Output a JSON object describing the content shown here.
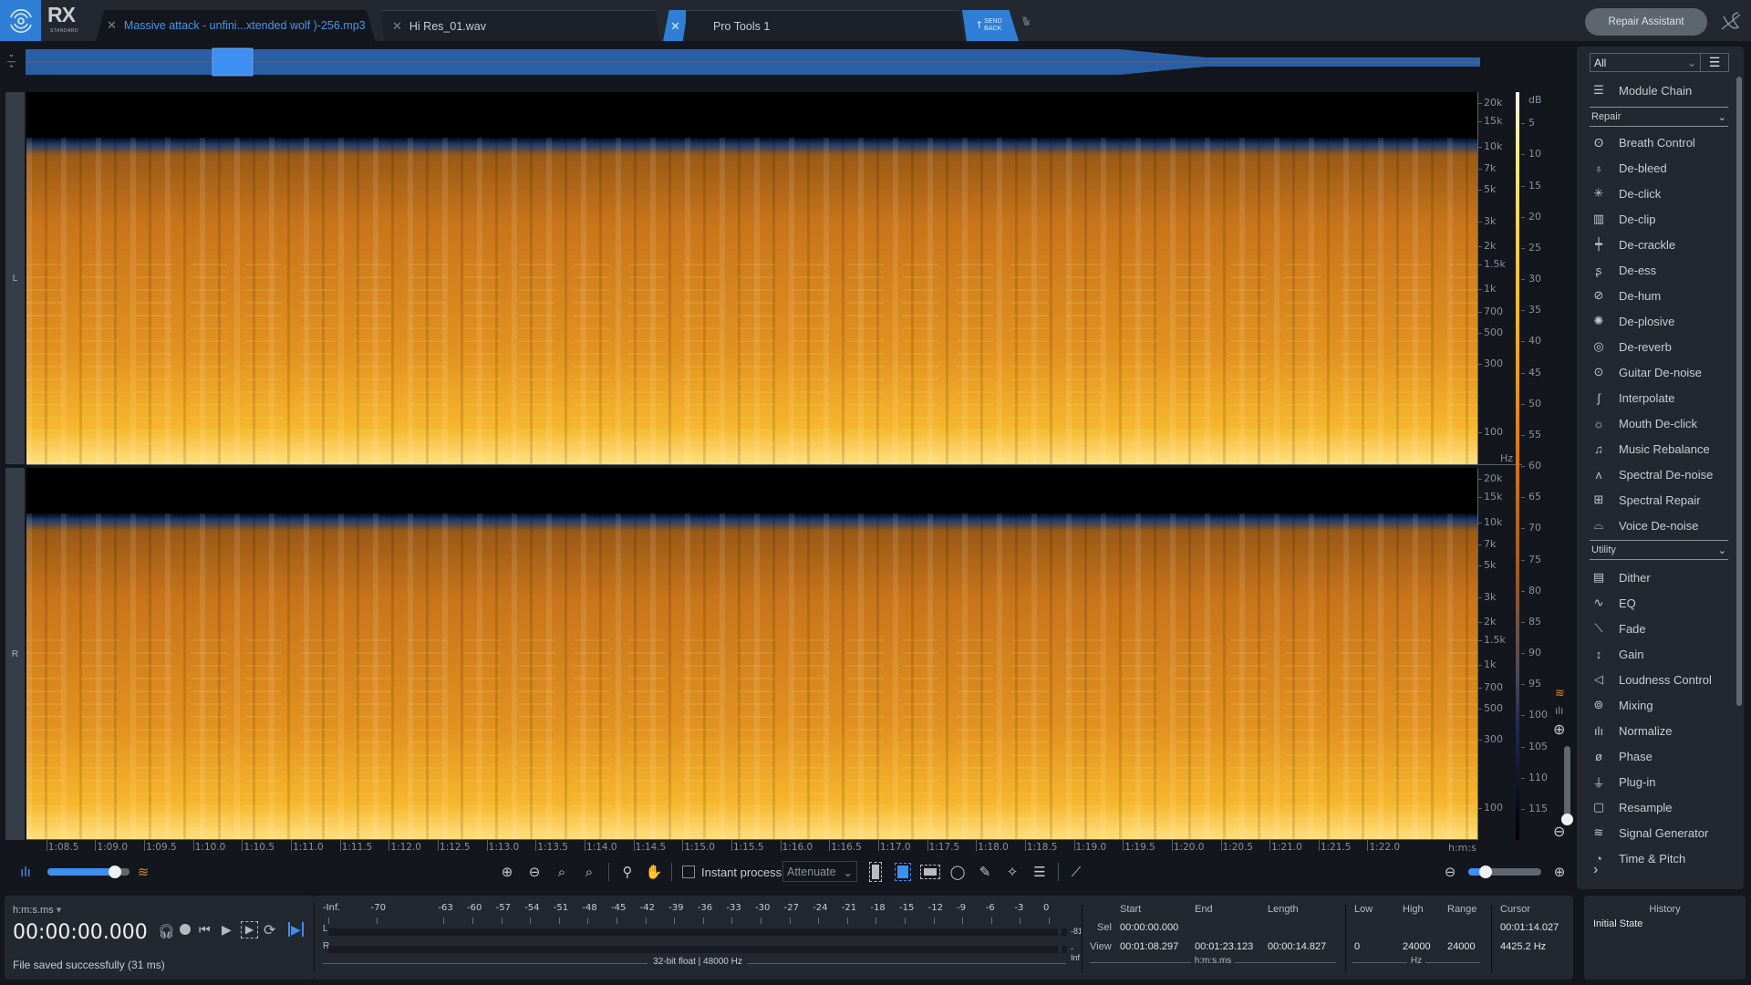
{
  "app": {
    "name": "RX",
    "edition": "STANDARD"
  },
  "tabs": [
    {
      "label": "Massive attack - unfini...xtended wolf )-256.mp3",
      "active": true
    },
    {
      "label": "Hi Res_01.wav",
      "active": false
    },
    {
      "label": "Pro Tools 1",
      "active": false
    }
  ],
  "send_back": {
    "line1": "SEND",
    "line2": "BACK"
  },
  "repair_assistant": "Repair Assistant",
  "channels": {
    "left": "L",
    "right": "R"
  },
  "freq_axis": {
    "unit": "Hz",
    "ticks": [
      "20k",
      "15k",
      "10k",
      "7k",
      "5k",
      "3k",
      "2k",
      "1.5k",
      "1k",
      "700",
      "500",
      "300",
      "100"
    ]
  },
  "db_scale": {
    "unit": "dB",
    "ticks": [
      "5",
      "10",
      "15",
      "20",
      "25",
      "30",
      "35",
      "40",
      "45",
      "50",
      "55",
      "60",
      "65",
      "70",
      "75",
      "80",
      "85",
      "90",
      "95",
      "100",
      "105",
      "110",
      "115"
    ]
  },
  "time_axis": {
    "unit": "h:m:s",
    "ticks": [
      "1:08.5",
      "1:09.0",
      "1:09.5",
      "1:10.0",
      "1:10.5",
      "1:11.0",
      "1:11.5",
      "1:12.0",
      "1:12.5",
      "1:13.0",
      "1:13.5",
      "1:14.0",
      "1:14.5",
      "1:15.0",
      "1:15.5",
      "1:16.0",
      "1:16.5",
      "1:17.0",
      "1:17.5",
      "1:18.0",
      "1:18.5",
      "1:19.0",
      "1:19.5",
      "1:20.0",
      "1:20.5",
      "1:21.0",
      "1:21.5",
      "1:22.0"
    ]
  },
  "toolbar": {
    "instant_process": "Instant process",
    "instant_process_checked": false,
    "mode": "Attenuate",
    "opacity_slider": 0.82,
    "zoom_slider": 0.15
  },
  "transport": {
    "time_format": "h:m:s.ms",
    "time": "00:00:00.000",
    "status": "File saved successfully (31 ms)"
  },
  "meter": {
    "scale": [
      "-Inf.",
      "-70",
      "-63",
      "-60",
      "-57",
      "-54",
      "-51",
      "-48",
      "-45",
      "-42",
      "-39",
      "-36",
      "-33",
      "-30",
      "-27",
      "-24",
      "-21",
      "-18",
      "-15",
      "-12",
      "-9",
      "-6",
      "-3",
      "0"
    ],
    "left_label": "L",
    "right_label": "R",
    "left_peak": "-81",
    "right_peak": "-Inf.",
    "format": "32-bit float | 48000 Hz"
  },
  "selection": {
    "headers": {
      "start": "Start",
      "end": "End",
      "length": "Length",
      "low": "Low",
      "high": "High",
      "range": "Range",
      "cursor": "Cursor"
    },
    "sel": {
      "label": "Sel",
      "start": "00:00:00.000",
      "end": "",
      "length": "",
      "low": "",
      "high": "",
      "range": "",
      "cursor": "00:01:14.027"
    },
    "view": {
      "label": "View",
      "start": "00:01:08.297",
      "end": "00:01:23.123",
      "length": "00:00:14.827",
      "low": "0",
      "high": "24000",
      "range": "24000",
      "cursor": "4425.2 Hz"
    },
    "time_unit": "h:m:s.ms",
    "freq_unit": "Hz"
  },
  "history": {
    "title": "History",
    "items": [
      "Initial State"
    ]
  },
  "modules": {
    "filter": "All",
    "module_chain": "Module Chain",
    "repair_title": "Repair",
    "repair": [
      "Breath Control",
      "De-bleed",
      "De-click",
      "De-clip",
      "De-crackle",
      "De-ess",
      "De-hum",
      "De-plosive",
      "De-reverb",
      "Guitar De-noise",
      "Interpolate",
      "Mouth De-click",
      "Music Rebalance",
      "Spectral De-noise",
      "Spectral Repair",
      "Voice De-noise"
    ],
    "utility_title": "Utility",
    "utility": [
      "Dither",
      "EQ",
      "Fade",
      "Gain",
      "Loudness Control",
      "Mixing",
      "Normalize",
      "Phase",
      "Plug-in",
      "Resample",
      "Signal Generator",
      "Time & Pitch"
    ]
  },
  "colors": {
    "accent": "#2f7fd6",
    "tab_active_text": "#4a94e8",
    "panel": "#232830",
    "background": "#13161d"
  }
}
